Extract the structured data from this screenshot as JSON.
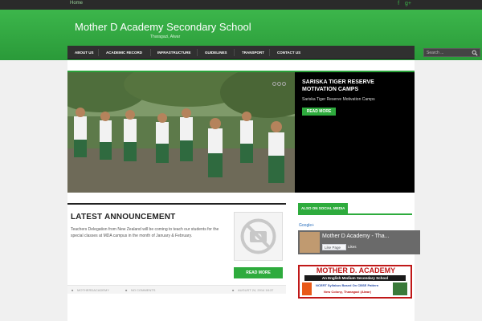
{
  "topbar": {
    "home_label": "Home",
    "social_icons": [
      "facebook-icon",
      "google-plus-icon"
    ]
  },
  "site": {
    "title": "Mother D Academy Secondary School",
    "subtitle": "Tharagazi, Alwar"
  },
  "nav": {
    "items": [
      "ABOUT US",
      "ACADEMIC RECORD",
      "INFRASTRUCTURE",
      "GUIDELINES",
      "TRANSPORT",
      "CONTACT US"
    ],
    "search_placeholder": "Search ..."
  },
  "slider": {
    "title": "SARISKA TIGER RESERVE MOTIVATION CAMPS",
    "text": "Sariska Tiger Reserve Motivation Camps",
    "button": "READ MORE"
  },
  "announcement": {
    "title": "LATEST ANNOUNCEMENT",
    "text": "Teachers Delegation from New Zealand will be coming to teach our students for the special classes at MDA campus in the month of January & February.",
    "button": "READ MORE",
    "author": "MOTHERDACADEMY",
    "comments": "NO COMMENTS",
    "date": "AUGUST 24, 2014 18:37"
  },
  "sidebar": {
    "widget_title": "ALSO ON SOCIAL MEDIA",
    "gplus_label": "Google+",
    "fb_name": "Mother D Academy - Tha...",
    "fb_like": "Like Page",
    "fb_likes": "Likes",
    "banner_title": "MOTHER D. ACADEMY",
    "banner_sub": "An English Medium Secondary School",
    "banner_line": "NCERT Syllabus Based On CBSE Pattern",
    "banner_addr": "New Colony, Thanagazi (Alwar)"
  },
  "colors": {
    "accent": "#2eab3d",
    "nav_bg": "#303030",
    "header_bg": "#3cb64b"
  }
}
